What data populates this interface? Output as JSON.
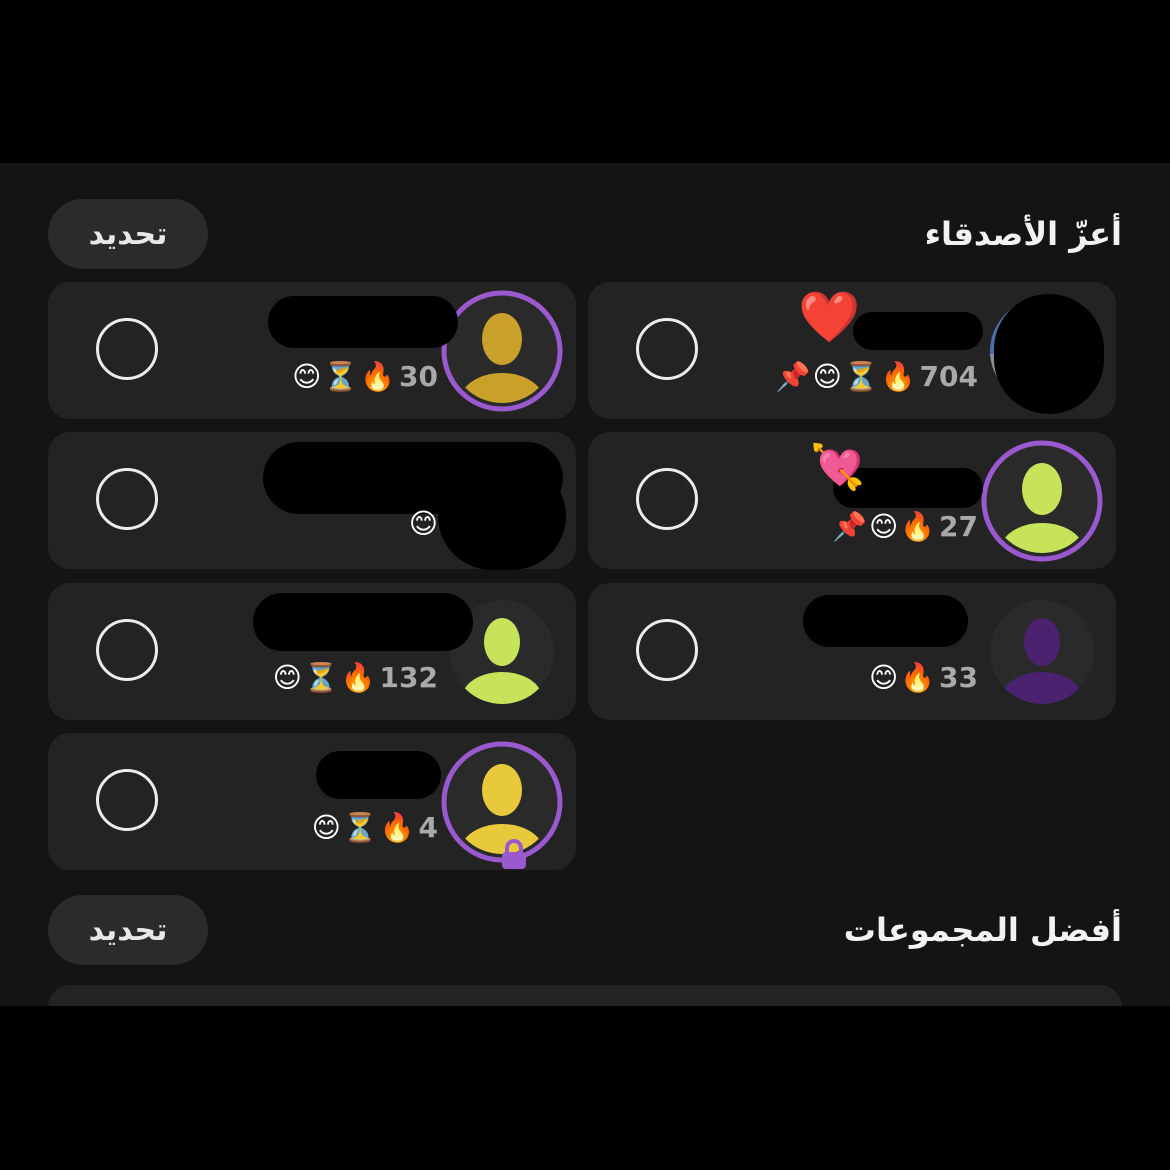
{
  "best_friends": {
    "title": "أعزّ الأصدقاء",
    "select_label": "تحديد",
    "friends": [
      {
        "name": "",
        "emojis": [
          "📌",
          "😊",
          "⏳",
          "🔥"
        ],
        "count": "704",
        "extra_emoji": "❤️",
        "avatar": "photo"
      },
      {
        "name": "",
        "emojis": [
          "😊",
          "⏳",
          "🔥"
        ],
        "count": "30",
        "avatar": "bitmoji-gold",
        "ring": true
      },
      {
        "name": "",
        "emojis": [
          "📌",
          "😊",
          "🔥"
        ],
        "count": "27",
        "extra_emoji": "💘",
        "avatar": "bitmoji-lime",
        "ring": true
      },
      {
        "name": "",
        "emojis": [
          "😊"
        ],
        "count": "",
        "avatar": "hidden"
      },
      {
        "name": "",
        "emojis": [
          "😊",
          "🔥"
        ],
        "count": "33",
        "avatar": "bitmoji-purple"
      },
      {
        "name": "",
        "emojis": [
          "😊",
          "⏳",
          "🔥"
        ],
        "count": "132",
        "avatar": "bitmoji-lime"
      },
      {
        "name": "",
        "emojis": [
          "😊",
          "⏳",
          "🔥"
        ],
        "count": "4",
        "avatar": "bitmoji-yellow",
        "ring": true,
        "locked": true
      }
    ]
  },
  "best_groups": {
    "title": "أفضل المجموعات",
    "select_label": "تحديد"
  },
  "colors": {
    "background": "#141414",
    "card": "#232323",
    "ring": "#9b59d0",
    "gold": "#c9a12a",
    "lime": "#c6e35a",
    "purple": "#4a2270",
    "yellow": "#e8c93c"
  }
}
